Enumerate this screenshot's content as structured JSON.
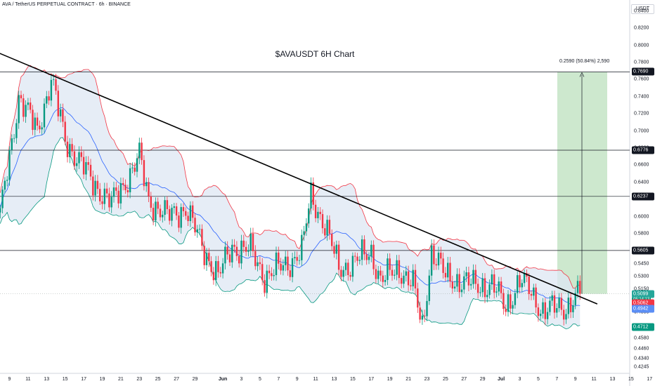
{
  "header": {
    "symbol_line": "AVA / TetherUS PERPETUAL CONTRACT · 6h · BINANCE"
  },
  "unit_label": "USDT",
  "chart_data": {
    "type": "candlestick",
    "title": "$AVAUSDT 6H Chart",
    "ylim": [
      0.417,
      0.853
    ],
    "y_ticks": [
      "0.8400",
      "0.8200",
      "0.8000",
      "0.7800",
      "0.7600",
      "0.7400",
      "0.7200",
      "0.7000",
      "0.6800",
      "0.6600",
      "0.6400",
      "0.6200",
      "0.6000",
      "0.5800",
      "0.5600",
      "0.5450",
      "0.5300",
      "0.5150",
      "0.5000",
      "0.4880",
      "0.4580",
      "0.4460",
      "0.4340",
      "0.4245"
    ],
    "y_tick_values": [
      0.84,
      0.82,
      0.8,
      0.78,
      0.76,
      0.74,
      0.72,
      0.7,
      0.68,
      0.66,
      0.64,
      0.62,
      0.6,
      0.58,
      0.56,
      0.545,
      0.53,
      0.515,
      0.5,
      0.488,
      0.458,
      0.446,
      0.434,
      0.4245
    ],
    "x_ticks": [
      "9",
      "11",
      "13",
      "15",
      "17",
      "19",
      "21",
      "23",
      "25",
      "27",
      "29",
      "Jun",
      "3",
      "5",
      "7",
      "9",
      "11",
      "13",
      "15",
      "17",
      "19",
      "21",
      "23",
      "25",
      "27",
      "29",
      "Jul",
      "3",
      "5",
      "7",
      "9",
      "11",
      "13",
      "15",
      "17"
    ],
    "x_bold": [
      "Jun",
      "Jul"
    ],
    "horizontal_levels": [
      {
        "label": "0.7690",
        "value": 0.769
      },
      {
        "label": "0.6776",
        "value": 0.6776
      },
      {
        "label": "0.6237",
        "value": 0.6237
      },
      {
        "label": "0.5605",
        "value": 0.5605
      }
    ],
    "price_labels": [
      {
        "label": "0.5099",
        "value": 0.5099,
        "style": "green",
        "sub": "05:14:13"
      },
      {
        "label": "0.5062",
        "value": 0.5062,
        "style": "red"
      },
      {
        "label": "0.4942",
        "value": 0.4942,
        "style": "blue"
      },
      {
        "label": "0.4712",
        "value": 0.4712,
        "style": "teal"
      }
    ],
    "trendline": {
      "from_date": "May 7",
      "from_price": 0.795,
      "to_date": "Jul 10",
      "to_price": 0.502
    },
    "measure": {
      "label": "0.2590 (50.84%) 2,590",
      "from": 0.5099,
      "to": 0.769
    },
    "anchors": [
      {
        "date": "May 8",
        "price": 0.6
      },
      {
        "date": "May 10",
        "price": 0.74
      },
      {
        "date": "May 12",
        "price": 0.7
      },
      {
        "date": "May 13.5",
        "price": 0.76
      },
      {
        "date": "May 15",
        "price": 0.69
      },
      {
        "date": "May 18",
        "price": 0.64
      },
      {
        "date": "May 20",
        "price": 0.615
      },
      {
        "date": "May 22",
        "price": 0.65
      },
      {
        "date": "May 23",
        "price": 0.67
      },
      {
        "date": "May 24",
        "price": 0.62
      },
      {
        "date": "May 26",
        "price": 0.6
      },
      {
        "date": "May 28",
        "price": 0.61
      },
      {
        "date": "May 30",
        "price": 0.56
      },
      {
        "date": "May 31.5",
        "price": 0.53
      },
      {
        "date": "Jun 2",
        "price": 0.565
      },
      {
        "date": "Jun 4",
        "price": 0.56
      },
      {
        "date": "Jun 5.5",
        "price": 0.53
      },
      {
        "date": "Jun 8",
        "price": 0.545
      },
      {
        "date": "Jun 9.5",
        "price": 0.56
      },
      {
        "date": "Jun 10.5",
        "price": 0.625
      },
      {
        "date": "Jun 12",
        "price": 0.59
      },
      {
        "date": "Jun 13.5",
        "price": 0.54
      },
      {
        "date": "Jun 15",
        "price": 0.545
      },
      {
        "date": "Jun 17",
        "price": 0.56
      },
      {
        "date": "Jun 18",
        "price": 0.525
      },
      {
        "date": "Jun 20",
        "price": 0.54
      },
      {
        "date": "Jun 21.5",
        "price": 0.52
      },
      {
        "date": "Jun 22.5",
        "price": 0.47
      },
      {
        "date": "Jun 23.5",
        "price": 0.56
      },
      {
        "date": "Jun 25",
        "price": 0.53
      },
      {
        "date": "Jun 28",
        "price": 0.52
      },
      {
        "date": "Jun 30",
        "price": 0.52
      },
      {
        "date": "Jul 1.5",
        "price": 0.495
      },
      {
        "date": "Jul 3",
        "price": 0.525
      },
      {
        "date": "Jul 4",
        "price": 0.515
      },
      {
        "date": "Jul 5.5",
        "price": 0.49
      },
      {
        "date": "Jul 7",
        "price": 0.493
      },
      {
        "date": "Jul 8",
        "price": 0.495
      },
      {
        "date": "Jul 9.5",
        "price": 0.5099
      }
    ],
    "colors": {
      "up": "#089981",
      "down": "#f23645",
      "band_fill": "#dde7f3",
      "upper_band": "#f23645",
      "lower_band": "#089981",
      "basis": "#2962ff",
      "trend": "#000000",
      "target_zone": "#c8e6c9"
    }
  }
}
